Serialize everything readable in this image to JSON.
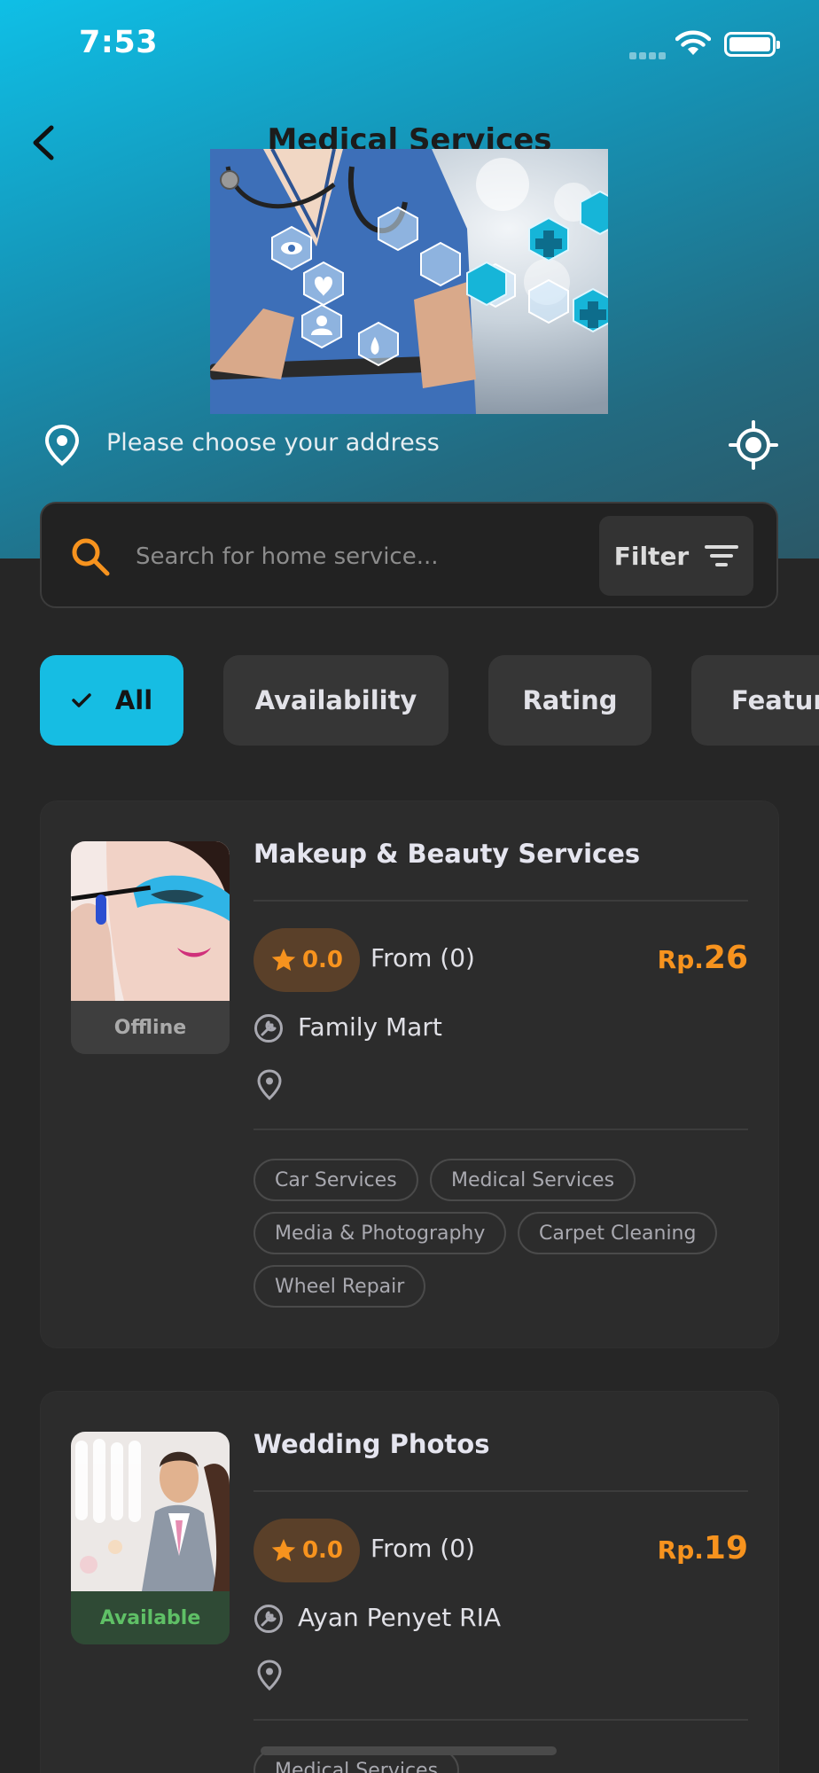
{
  "status_bar": {
    "time": "7:53"
  },
  "header": {
    "title": "Medical Services"
  },
  "address": {
    "placeholder_text": "Please choose your address"
  },
  "search": {
    "placeholder": "Search for home service...",
    "value": "",
    "filter_label": "Filter"
  },
  "filters": [
    {
      "label": "All",
      "selected": true
    },
    {
      "label": "Availability",
      "selected": false
    },
    {
      "label": "Rating",
      "selected": false
    },
    {
      "label": "Featured",
      "selected": false
    }
  ],
  "services": [
    {
      "title": "Makeup & Beauty Services",
      "status": "Offline",
      "rating": "0.0",
      "reviews_text": "From (0)",
      "price_prefix": "Rp.",
      "price_value": "26",
      "provider": "Family Mart",
      "location": "",
      "tags": [
        "Car Services",
        "Medical Services",
        "Media & Photography",
        "Carpet Cleaning",
        "Wheel Repair"
      ]
    },
    {
      "title": "Wedding Photos",
      "status": "Available",
      "rating": "0.0",
      "reviews_text": "From (0)",
      "price_prefix": "Rp.",
      "price_value": "19",
      "provider": "Ayan Penyet RIA",
      "location": "",
      "tags": [
        "Medical Services"
      ]
    }
  ],
  "colors": {
    "accent": "#16bde3",
    "price": "#f7931e",
    "available": "#5fc066",
    "background": "#262626",
    "card": "#2c2c2c"
  },
  "icons": [
    "back-arrow-icon",
    "map-pin-icon",
    "locate-icon",
    "search-icon",
    "filter-icon",
    "check-icon",
    "star-icon",
    "wrench-icon",
    "wifi-icon",
    "battery-icon"
  ]
}
